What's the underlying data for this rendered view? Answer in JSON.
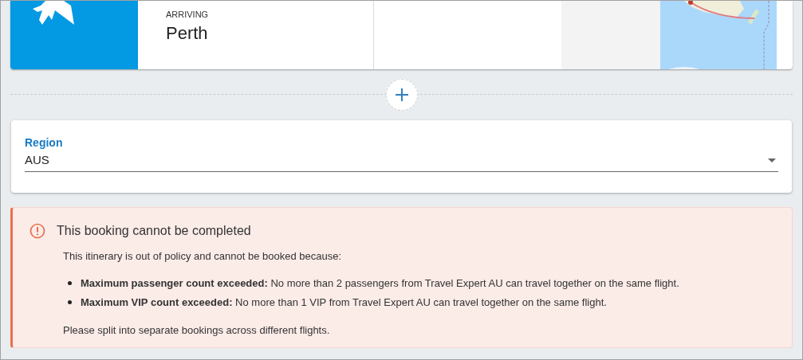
{
  "flight": {
    "label": "ARRIVING",
    "city": "Perth"
  },
  "region": {
    "label": "Region",
    "value": "AUS"
  },
  "alert": {
    "title": "This booking cannot be completed",
    "intro": "This itinerary is out of policy and cannot be booked because:",
    "reasons": [
      {
        "text": "**Maximum passenger count exceeded:** No more than 2 passengers from Travel Expert AU can travel together on the same flight."
      },
      {
        "text": "**Maximum VIP count exceeded:** No more than 1 VIP from Travel Expert AU can travel together on the same flight."
      }
    ],
    "footer": "Please split into separate bookings across different flights."
  }
}
